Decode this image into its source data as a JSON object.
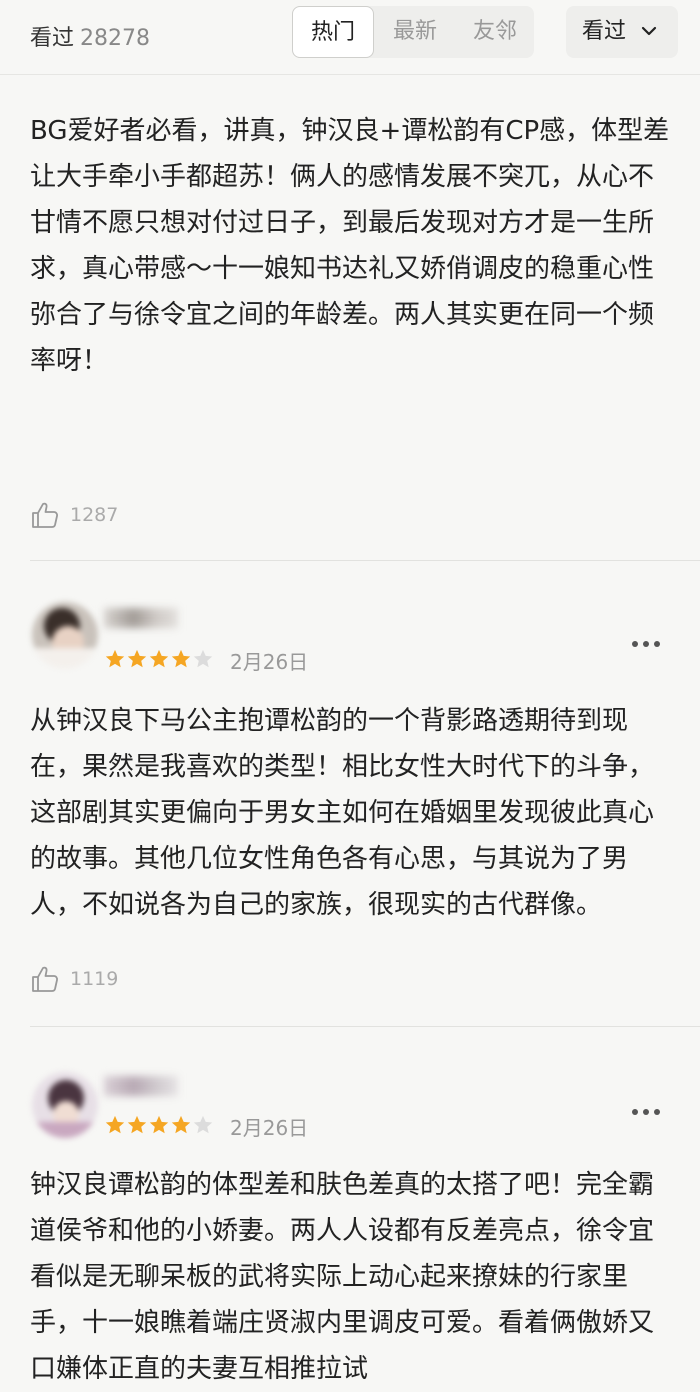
{
  "header": {
    "count_label": "看过",
    "count_value": "28278",
    "tabs": [
      "热门",
      "最新",
      "友邻"
    ],
    "active_tab": "热门",
    "filter_label": "看过"
  },
  "reviews": [
    {
      "text": "BG爱好者必看，讲真，钟汉良+谭松韵有CP感，体型差让大手牵小手都超苏！俩人的感情发展不突兀，从心不甘情不愿只想对付过日子，到最后发现对方才是一生所求，真心带感～十一娘知书达礼又娇俏调皮的稳重心性弥合了与徐令宜之间的年龄差。两人其实更在同一个频率呀！",
      "likes": "1287"
    },
    {
      "rating": 4,
      "date": "2月26日",
      "text": "从钟汉良下马公主抱谭松韵的一个背影路透期待到现在，果然是我喜欢的类型！相比女性大时代下的斗争，这部剧其实更偏向于男女主如何在婚姻里发现彼此真心的故事。其他几位女性角色各有心思，与其说为了男人，不如说各为自己的家族，很现实的古代群像。",
      "likes": "1119"
    },
    {
      "rating": 4,
      "date": "2月26日",
      "text": "钟汉良谭松韵的体型差和肤色差真的太搭了吧！完全霸道侯爷和他的小娇妻。两人人设都有反差亮点，徐令宜看似是无聊呆板的武将实际上动心起来撩妹的行家里手，十一娘瞧着端庄贤淑内里调皮可爱。看着俩傲娇又口嫌体正直的夫妻互相推拉试"
    }
  ],
  "colors": {
    "star_on": "#f5a623",
    "star_off": "#dcdcdc",
    "background": "#f7f7f5"
  }
}
